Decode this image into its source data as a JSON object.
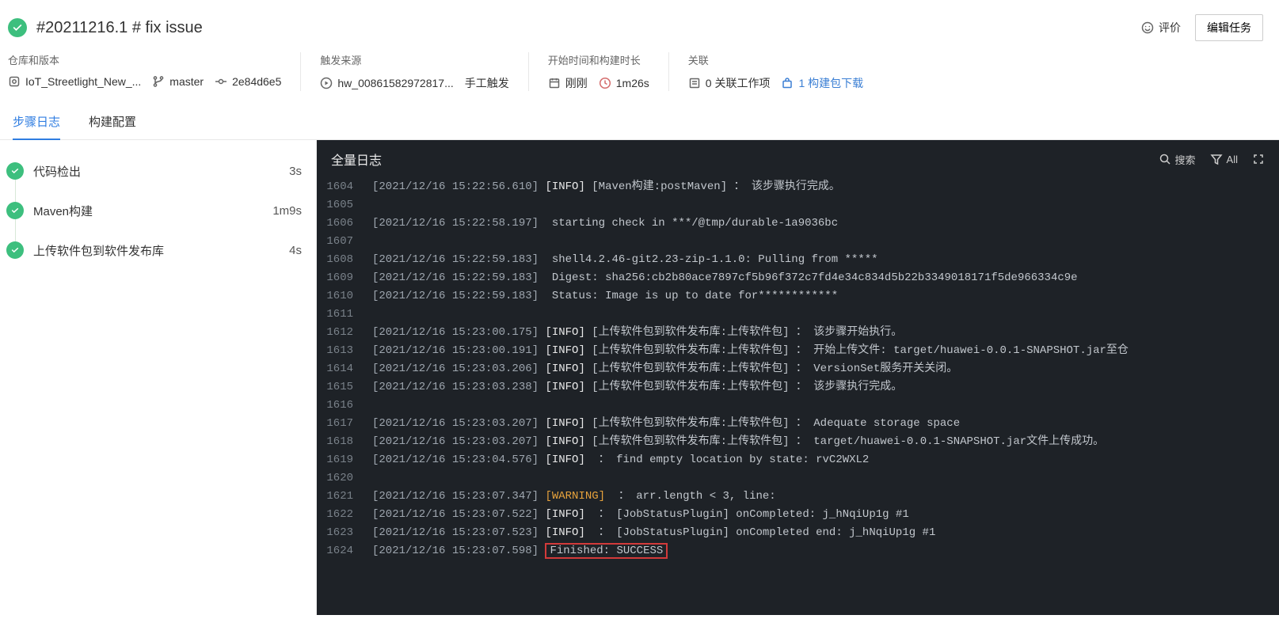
{
  "header": {
    "title": "#20211216.1  # fix issue",
    "rate_label": "评价",
    "edit_label": "编辑任务"
  },
  "info": {
    "group1": {
      "label": "仓库和版本",
      "repo": "IoT_Streetlight_New_...",
      "branch": "master",
      "commit": "2e84d6e5"
    },
    "group2": {
      "label": "触发来源",
      "user": "hw_00861582972817...",
      "trigger": "手工触发"
    },
    "group3": {
      "label": "开始时间和构建时长",
      "start": "刚刚",
      "duration": "1m26s"
    },
    "group4": {
      "label": "关联",
      "workitems": "0 关联工作项",
      "download": "1 构建包下载"
    }
  },
  "tabs": {
    "log": "步骤日志",
    "config": "构建配置"
  },
  "steps": [
    {
      "name": "代码检出",
      "time": "3s"
    },
    {
      "name": "Maven构建",
      "time": "1m9s"
    },
    {
      "name": "上传软件包到软件发布库",
      "time": "4s"
    }
  ],
  "log": {
    "title": "全量日志",
    "search": "搜索",
    "all": "All",
    "lines": [
      {
        "n": "1604",
        "ts": "[2021/12/16 15:22:56.610]",
        "tag": "[INFO]",
        "rest": " [Maven构建:postMaven] ： 该步骤执行完成。"
      },
      {
        "n": "1605",
        "ts": "",
        "tag": "",
        "rest": ""
      },
      {
        "n": "1606",
        "ts": "[2021/12/16 15:22:58.197]",
        "tag": "",
        "rest": " starting check in ***/@tmp/durable-1a9036bc"
      },
      {
        "n": "1607",
        "ts": "",
        "tag": "",
        "rest": ""
      },
      {
        "n": "1608",
        "ts": "[2021/12/16 15:22:59.183]",
        "tag": "",
        "rest": " shell4.2.46-git2.23-zip-1.1.0: Pulling from *****"
      },
      {
        "n": "1609",
        "ts": "[2021/12/16 15:22:59.183]",
        "tag": "",
        "rest": " Digest: sha256:cb2b80ace7897cf5b96f372c7fd4e34c834d5b22b3349018171f5de966334c9e"
      },
      {
        "n": "1610",
        "ts": "[2021/12/16 15:22:59.183]",
        "tag": "",
        "rest": " Status: Image is up to date for************"
      },
      {
        "n": "1611",
        "ts": "",
        "tag": "",
        "rest": ""
      },
      {
        "n": "1612",
        "ts": "[2021/12/16 15:23:00.175]",
        "tag": "[INFO]",
        "rest": " [上传软件包到软件发布库:上传软件包] ： 该步骤开始执行。"
      },
      {
        "n": "1613",
        "ts": "[2021/12/16 15:23:00.191]",
        "tag": "[INFO]",
        "rest": " [上传软件包到软件发布库:上传软件包] ： 开始上传文件: target/huawei-0.0.1-SNAPSHOT.jar至仓"
      },
      {
        "n": "1614",
        "ts": "[2021/12/16 15:23:03.206]",
        "tag": "[INFO]",
        "rest": " [上传软件包到软件发布库:上传软件包] ： VersionSet服务开关关闭。"
      },
      {
        "n": "1615",
        "ts": "[2021/12/16 15:23:03.238]",
        "tag": "[INFO]",
        "rest": " [上传软件包到软件发布库:上传软件包] ： 该步骤执行完成。"
      },
      {
        "n": "1616",
        "ts": "",
        "tag": "",
        "rest": ""
      },
      {
        "n": "1617",
        "ts": "[2021/12/16 15:23:03.207]",
        "tag": "[INFO]",
        "rest": " [上传软件包到软件发布库:上传软件包] ： Adequate storage space"
      },
      {
        "n": "1618",
        "ts": "[2021/12/16 15:23:03.207]",
        "tag": "[INFO]",
        "rest": " [上传软件包到软件发布库:上传软件包] ： target/huawei-0.0.1-SNAPSHOT.jar文件上传成功。"
      },
      {
        "n": "1619",
        "ts": "[2021/12/16 15:23:04.576]",
        "tag": "[INFO]",
        "rest": "  ： find empty location by state: rvC2WXL2"
      },
      {
        "n": "1620",
        "ts": "",
        "tag": "",
        "rest": ""
      },
      {
        "n": "1621",
        "ts": "[2021/12/16 15:23:07.347]",
        "tag": "[WARNING]",
        "tagClass": "warn-tag",
        "rest": "  ： arr.length < 3, line:"
      },
      {
        "n": "1622",
        "ts": "[2021/12/16 15:23:07.522]",
        "tag": "[INFO]",
        "rest": "  ： [JobStatusPlugin] onCompleted: j_hNqiUp1g #1"
      },
      {
        "n": "1623",
        "ts": "[2021/12/16 15:23:07.523]",
        "tag": "[INFO]",
        "rest": "  ： [JobStatusPlugin] onCompleted end: j_hNqiUp1g #1"
      },
      {
        "n": "1624",
        "ts": "[2021/12/16 15:23:07.598]",
        "tag": "",
        "rest": "Finished: SUCCESS",
        "boxed": true
      }
    ]
  }
}
